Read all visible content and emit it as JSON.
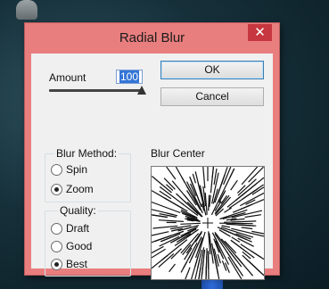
{
  "dialog": {
    "title": "Radial Blur",
    "close_glyph": "✕"
  },
  "amount": {
    "label": "Amount",
    "value": "100",
    "slider_fraction": 1.0
  },
  "buttons": {
    "ok": "OK",
    "cancel": "Cancel"
  },
  "blur_method": {
    "legend": "Blur Method:",
    "options": [
      "Spin",
      "Zoom"
    ],
    "selected": "Zoom"
  },
  "quality": {
    "legend": "Quality:",
    "options": [
      "Draft",
      "Good",
      "Best"
    ],
    "selected": "Best"
  },
  "blur_center": {
    "label": "Blur Center"
  },
  "colors": {
    "title_bar": "#e97e7e",
    "close_button": "#c7373f",
    "selection": "#3375d7"
  }
}
